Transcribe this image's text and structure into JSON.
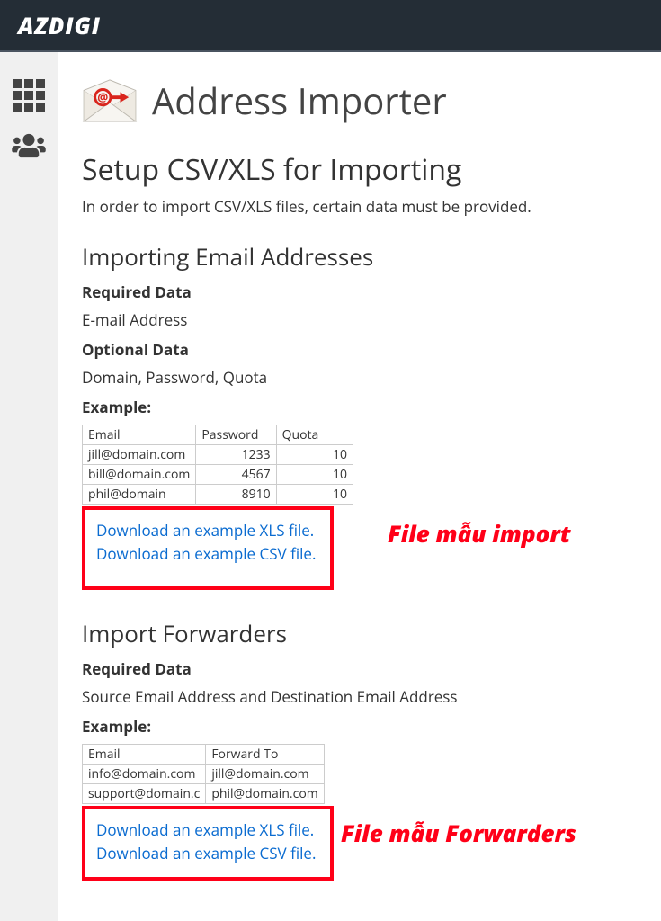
{
  "brand": "AZDIGI",
  "page_title": "Address Importer",
  "setup_heading": "Setup CSV/XLS for Importing",
  "setup_lead": "In order to import CSV/XLS files, certain data must be provided.",
  "emails": {
    "heading": "Importing Email Addresses",
    "required_label": "Required Data",
    "required_value": "E-mail Address",
    "optional_label": "Optional Data",
    "optional_value": "Domain, Password, Quota",
    "example_label": "Example:",
    "table": {
      "headers": [
        "Email",
        "Password",
        "Quota"
      ],
      "rows": [
        [
          "jill@domain.com",
          "1233",
          "10"
        ],
        [
          "bill@domain.com",
          "4567",
          "10"
        ],
        [
          "phil@domain",
          "8910",
          "10"
        ]
      ]
    },
    "download_xls": "Download an example XLS file.",
    "download_csv": "Download an example CSV file.",
    "annotation": "File mẫu import"
  },
  "forwarders": {
    "heading": "Import Forwarders",
    "required_label": "Required Data",
    "required_value": "Source Email Address and Destination Email Address",
    "example_label": "Example:",
    "table": {
      "headers": [
        "Email",
        "Forward To"
      ],
      "rows": [
        [
          "info@domain.com",
          "jill@domain.com"
        ],
        [
          "support@domain.c",
          "phil@domain.com"
        ]
      ]
    },
    "download_xls": "Download an example XLS file.",
    "download_csv": "Download an example CSV file.",
    "annotation": "File mẫu Forwarders"
  }
}
